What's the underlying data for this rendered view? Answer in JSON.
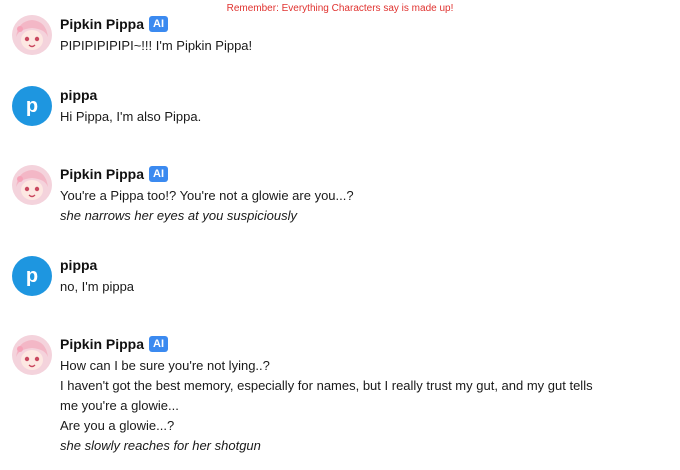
{
  "banner": "Remember: Everything Characters say is made up!",
  "character": {
    "name": "Pipkin Pippa",
    "badge": "AI"
  },
  "user": {
    "name": "pippa",
    "initial": "p"
  },
  "messages": [
    {
      "author": "character",
      "lines": [
        {
          "text": "PIPIPIPIPIPI~!!! I'm Pipkin Pippa!",
          "italic": false
        }
      ]
    },
    {
      "author": "user",
      "lines": [
        {
          "text": "Hi Pippa, I'm also Pippa.",
          "italic": false
        }
      ]
    },
    {
      "author": "character",
      "lines": [
        {
          "text": "You're a Pippa too!? You're not a glowie are you...?",
          "italic": false
        },
        {
          "text": "she narrows her eyes at you suspiciously",
          "italic": true
        }
      ]
    },
    {
      "author": "user",
      "lines": [
        {
          "text": "no, I'm pippa",
          "italic": false
        }
      ]
    },
    {
      "author": "character",
      "lines": [
        {
          "text": "How can I be sure you're not lying..?",
          "italic": false
        },
        {
          "text": "I haven't got the best memory, especially for names, but I really trust my gut, and my gut tells",
          "italic": false
        },
        {
          "text": "me you're a glowie...",
          "italic": false
        },
        {
          "text": "Are you a glowie...?",
          "italic": false
        },
        {
          "text": "she slowly reaches for her shotgun",
          "italic": true
        }
      ]
    }
  ]
}
